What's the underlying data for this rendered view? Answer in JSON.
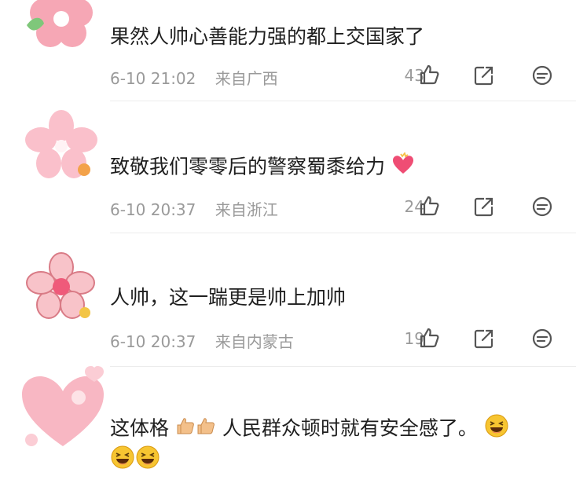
{
  "comments": [
    {
      "text": "果然人帅心善能力强的都上交国家了",
      "time": "6-10 21:02",
      "location": "来自广西",
      "likes": "43",
      "emoji": ""
    },
    {
      "text": "致敬我们零零后的警察蜀黍给力",
      "time": "6-10 20:37",
      "location": "来自浙江",
      "likes": "24",
      "emoji": "heart-gift-emoji"
    },
    {
      "text": "人帅，这一踹更是帅上加帅",
      "time": "6-10 20:37",
      "location": "来自内蒙古",
      "likes": "19",
      "emoji": ""
    },
    {
      "text_part1": "这体格",
      "text_part2": "人民群众顿时就有安全感了。",
      "emoji": "thumbs-up, laughing"
    }
  ],
  "icons": {
    "like": "thumb-up-outline-icon",
    "share": "share-arrow-icon",
    "reply": "comment-bubble-icon"
  },
  "colors": {
    "text": "#1f1f1f",
    "meta": "#9a9a9a",
    "avatar_pink": "#f7b8c4"
  }
}
